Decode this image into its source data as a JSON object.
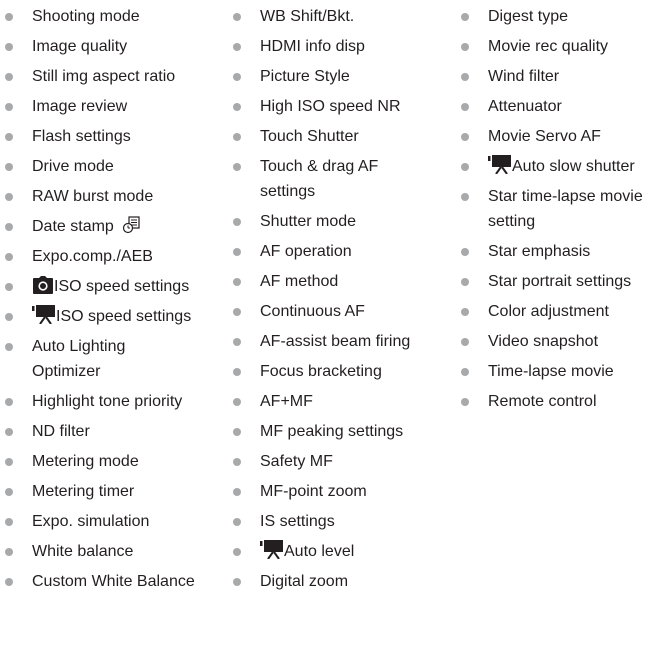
{
  "colors": {
    "text": "#231f20",
    "bullet": "#a7a9ab",
    "icon": "#231f20"
  },
  "columns": [
    {
      "items": [
        {
          "label": "Shooting mode"
        },
        {
          "label": "Image quality"
        },
        {
          "label": "Still img aspect ratio"
        },
        {
          "label": "Image review"
        },
        {
          "label": "Flash settings"
        },
        {
          "label": "Drive mode"
        },
        {
          "label": "RAW burst mode"
        },
        {
          "label": "Date stamp",
          "icon_after": "date-stamp-icon"
        },
        {
          "label": "Expo.comp./AEB"
        },
        {
          "label": "ISO speed settings",
          "icon_before": "camera-icon"
        },
        {
          "label": "ISO speed settings",
          "icon_before": "movie-camera-icon"
        },
        {
          "label_line1": "Auto Lighting",
          "label_line2": "Optimizer"
        },
        {
          "label": "Highlight tone priority"
        },
        {
          "label": "ND filter"
        },
        {
          "label": "Metering mode"
        },
        {
          "label": "Metering timer"
        },
        {
          "label": "Expo. simulation"
        },
        {
          "label": "White balance"
        },
        {
          "label": "Custom White Balance"
        }
      ]
    },
    {
      "items": [
        {
          "label": "WB Shift/Bkt."
        },
        {
          "label": "HDMI info disp"
        },
        {
          "label": "Picture Style"
        },
        {
          "label": "High ISO speed NR"
        },
        {
          "label": "Touch Shutter"
        },
        {
          "label_line1": "Touch & drag AF",
          "label_line2": "settings"
        },
        {
          "label": "Shutter mode"
        },
        {
          "label": "AF operation"
        },
        {
          "label": "AF method"
        },
        {
          "label": "Continuous AF"
        },
        {
          "label": "AF-assist beam firing"
        },
        {
          "label": "Focus bracketing"
        },
        {
          "label": "AF+MF"
        },
        {
          "label": "MF peaking settings"
        },
        {
          "label": "Safety MF"
        },
        {
          "label": "MF-point zoom"
        },
        {
          "label": "IS settings"
        },
        {
          "label": "Auto level",
          "icon_before": "movie-camera-icon"
        },
        {
          "label": "Digital zoom"
        }
      ]
    },
    {
      "items": [
        {
          "label": "Digest type"
        },
        {
          "label": "Movie rec quality"
        },
        {
          "label": "Wind filter"
        },
        {
          "label": "Attenuator"
        },
        {
          "label": "Movie Servo AF"
        },
        {
          "label": "Auto slow shutter",
          "icon_before": "movie-camera-icon"
        },
        {
          "label_line1": "Star time-lapse movie",
          "label_line2": "setting"
        },
        {
          "label": "Star emphasis"
        },
        {
          "label": "Star portrait settings"
        },
        {
          "label": "Color adjustment"
        },
        {
          "label": "Video snapshot"
        },
        {
          "label": "Time-lapse movie"
        },
        {
          "label": "Remote control"
        }
      ]
    }
  ]
}
